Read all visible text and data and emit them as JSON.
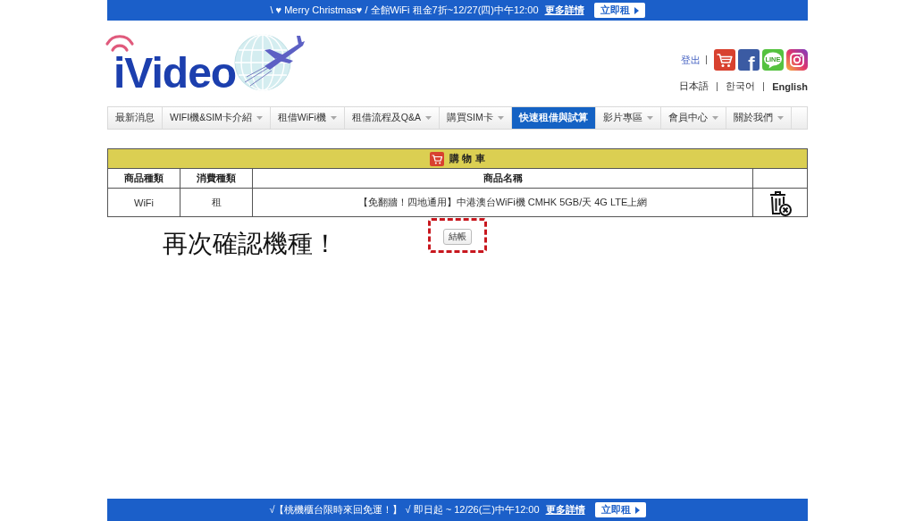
{
  "top_banner": {
    "text": "\\ ♥ Merry Christmas♥ / 全館WiFi 租金7折~12/27(四)中午12:00",
    "link": "更多詳情",
    "button": "立即租"
  },
  "header": {
    "logo": "iVideo",
    "logout": "登出",
    "social": [
      {
        "kind": "cart"
      },
      {
        "kind": "facebook",
        "glyph": "f"
      },
      {
        "kind": "line",
        "glyph": "LINE"
      },
      {
        "kind": "instagram"
      }
    ],
    "languages": [
      {
        "label": "日本語",
        "selected": false
      },
      {
        "label": "한국어",
        "selected": false
      },
      {
        "label": "English",
        "selected": true
      }
    ]
  },
  "nav": {
    "items": [
      {
        "label": "最新消息",
        "dropdown": false,
        "selected": false
      },
      {
        "label": "WIFI機&SIM卡介紹",
        "dropdown": true,
        "selected": false
      },
      {
        "label": "租借WiFi機",
        "dropdown": true,
        "selected": false
      },
      {
        "label": "租借流程及Q&A",
        "dropdown": true,
        "selected": false
      },
      {
        "label": "購買SIM卡",
        "dropdown": true,
        "selected": false
      },
      {
        "label": "快速租借與試算",
        "dropdown": false,
        "selected": true
      },
      {
        "label": "影片專區",
        "dropdown": true,
        "selected": false
      },
      {
        "label": "會員中心",
        "dropdown": true,
        "selected": false
      },
      {
        "label": "關於我們",
        "dropdown": true,
        "selected": false
      }
    ]
  },
  "cart": {
    "title": "購 物 車",
    "columns": [
      "商品種類",
      "消費種類",
      "商品名稱"
    ],
    "rows": [
      {
        "cells": [
          "WiFi",
          "租",
          "【免翻牆！四地通用】中港澳台WiFi機 CMHK 5GB/天 4G LTE上網"
        ]
      }
    ],
    "checkout_button": "結帳"
  },
  "annotation": {
    "text": "再次確認機種！"
  },
  "bottom_banner": {
    "text": "√【桃機櫃台限時來回免運！】 √ 即日起 ~ 12/26(三)中午12:00",
    "link": "更多詳情",
    "button": "立即租"
  }
}
